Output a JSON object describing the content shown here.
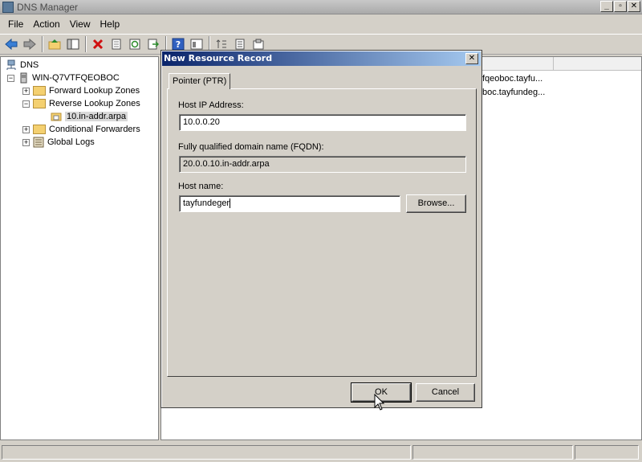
{
  "window": {
    "title": "DNS Manager",
    "buttons": [
      "_",
      "▫",
      "✕"
    ]
  },
  "menu": [
    "File",
    "Action",
    "View",
    "Help"
  ],
  "tree": {
    "root": "DNS",
    "server": "WIN-Q7VTFQEOBOC",
    "forward": "Forward Lookup Zones",
    "reverse": "Reverse Lookup Zones",
    "zone": "10.in-addr.arpa",
    "conditional": "Conditional Forwarders",
    "logs": "Global Logs"
  },
  "right_pane": {
    "rows": [
      "fqeoboc.tayfu...",
      "boc.tayfundeg..."
    ]
  },
  "dialog": {
    "title": "New Resource Record",
    "close": "✕",
    "tab": "Pointer (PTR)",
    "host_ip_label": "Host IP Address:",
    "host_ip_value": "10.0.0.20",
    "fqdn_label": "Fully qualified domain name (FQDN):",
    "fqdn_value": "20.0.0.10.in-addr.arpa",
    "host_name_label": "Host name:",
    "host_name_value": "tayfundeger",
    "browse_label": "Browse...",
    "ok_label": "OK",
    "cancel_label": "Cancel"
  }
}
